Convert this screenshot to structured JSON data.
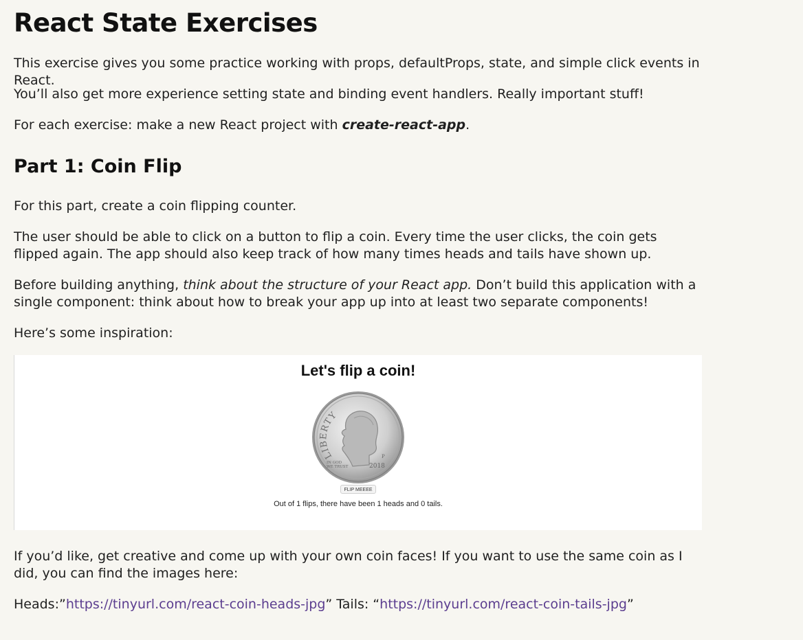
{
  "title": "React State Exercises",
  "intro": {
    "p1": "This exercise gives you some practice working with props, defaultProps, state, and simple click events in React.",
    "p2": "You’ll also get more experience setting state and binding event handlers. Really important stuff!",
    "p3_before": "For each exercise: make a new React project with ",
    "p3_strong": "create-react-app",
    "p3_after": "."
  },
  "part1": {
    "heading": "Part 1: Coin Flip",
    "p1": "For this part, create a coin flipping counter.",
    "p2": "The user should be able to click on a button to flip a coin. Every time the user clicks, the coin gets flipped again. The app should also keep track of how many times heads and tails have shown up.",
    "p3_before": "Before building anything, ",
    "p3_em": "think about the structure of your React app.",
    "p3_after": " Don’t build this application with a single component: think about how to break your app up into at least two separate components!",
    "p4": "Here’s some inspiration:",
    "demo": {
      "title": "Let's flip a coin!",
      "coin_word": "LIBERTY",
      "coin_motto_1": "IN GOD",
      "coin_motto_2": "WE TRUST",
      "coin_year": "2018",
      "coin_mint": "P",
      "button_label": "FLIP MEEEE",
      "caption": "Out of 1 flips, there have been 1 heads and 0 tails."
    },
    "p5": "If you’d like, get creative and come up with your own coin faces! If you want to use the same coin as I did, you can find the images here:",
    "links": {
      "heads_prefix": "Heads:”",
      "heads_url": "https://tinyurl.com/react-coin-heads-jpg",
      "middle": "” Tails: “",
      "tails_url": "https://tinyurl.com/react-coin-tails-jpg",
      "suffix": "”"
    }
  },
  "colors": {
    "page_background": "#f7f6f1",
    "link": "#5b3d8f",
    "text": "#1f1f1f"
  }
}
